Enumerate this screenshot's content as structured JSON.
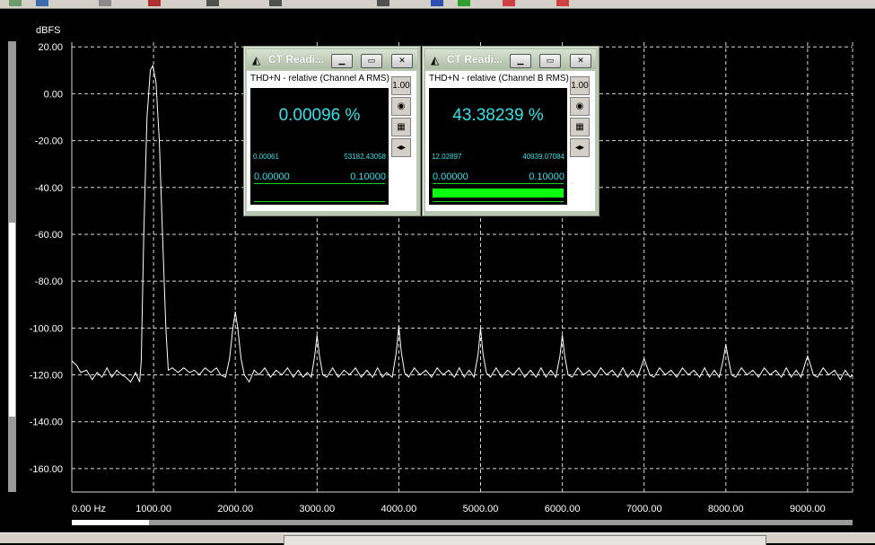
{
  "colors": {
    "background": "#000000",
    "grid": "#d8d8d8",
    "trace": "#ffffff",
    "readout_text": "#36e0e8",
    "bar_fill": "#0cff0c"
  },
  "chart_data": {
    "type": "line",
    "ylabel": "dBFS",
    "xunit": "0.00 Hz",
    "ylim": [
      -170,
      22
    ],
    "xlim": [
      0,
      9550
    ],
    "grid": true,
    "yticks": [
      {
        "v": 20,
        "label": "20.00"
      },
      {
        "v": 0,
        "label": "0.00"
      },
      {
        "v": -20,
        "label": "-20.00"
      },
      {
        "v": -40,
        "label": "-40.00"
      },
      {
        "v": -60,
        "label": "-60.00"
      },
      {
        "v": -80,
        "label": "-80.00"
      },
      {
        "v": -100,
        "label": "-100.00"
      },
      {
        "v": -120,
        "label": "-120.00"
      },
      {
        "v": -140,
        "label": "-140.00"
      },
      {
        "v": -160,
        "label": "-160.00"
      }
    ],
    "xticks": [
      {
        "v": 1000,
        "label": "1000.00"
      },
      {
        "v": 2000,
        "label": "2000.00"
      },
      {
        "v": 3000,
        "label": "3000.00"
      },
      {
        "v": 4000,
        "label": "4000.00"
      },
      {
        "v": 5000,
        "label": "5000.00"
      },
      {
        "v": 6000,
        "label": "6000.00"
      },
      {
        "v": 7000,
        "label": "7000.00"
      },
      {
        "v": 8000,
        "label": "8000.00"
      },
      {
        "v": 9000,
        "label": "9000.00"
      }
    ],
    "series": [
      {
        "points": [
          [
            0,
            -114
          ],
          [
            60,
            -116
          ],
          [
            110,
            -119
          ],
          [
            180,
            -118
          ],
          [
            250,
            -122
          ],
          [
            310,
            -119
          ],
          [
            370,
            -121
          ],
          [
            430,
            -117
          ],
          [
            490,
            -121
          ],
          [
            550,
            -118
          ],
          [
            610,
            -120
          ],
          [
            660,
            -121
          ],
          [
            720,
            -123
          ],
          [
            780,
            -119
          ],
          [
            830,
            -123
          ],
          [
            850,
            -114
          ],
          [
            880,
            -60
          ],
          [
            920,
            -10
          ],
          [
            960,
            10
          ],
          [
            990,
            12
          ],
          [
            1030,
            5
          ],
          [
            1070,
            -20
          ],
          [
            1110,
            -60
          ],
          [
            1150,
            -100
          ],
          [
            1180,
            -118
          ],
          [
            1230,
            -117
          ],
          [
            1300,
            -119
          ],
          [
            1370,
            -117
          ],
          [
            1440,
            -119
          ],
          [
            1500,
            -118
          ],
          [
            1560,
            -120
          ],
          [
            1630,
            -117
          ],
          [
            1700,
            -119
          ],
          [
            1770,
            -117
          ],
          [
            1820,
            -120
          ],
          [
            1880,
            -121
          ],
          [
            1930,
            -113
          ],
          [
            1970,
            -100
          ],
          [
            2000,
            -93
          ],
          [
            2030,
            -100
          ],
          [
            2070,
            -113
          ],
          [
            2110,
            -120
          ],
          [
            2170,
            -123
          ],
          [
            2230,
            -118
          ],
          [
            2290,
            -120
          ],
          [
            2360,
            -117
          ],
          [
            2430,
            -121
          ],
          [
            2500,
            -118
          ],
          [
            2570,
            -120
          ],
          [
            2640,
            -117
          ],
          [
            2710,
            -121
          ],
          [
            2770,
            -118
          ],
          [
            2830,
            -121
          ],
          [
            2880,
            -119
          ],
          [
            2930,
            -121
          ],
          [
            2970,
            -112
          ],
          [
            3000,
            -103
          ],
          [
            3030,
            -112
          ],
          [
            3070,
            -120
          ],
          [
            3120,
            -121
          ],
          [
            3190,
            -117
          ],
          [
            3260,
            -121
          ],
          [
            3330,
            -118
          ],
          [
            3400,
            -120
          ],
          [
            3470,
            -117
          ],
          [
            3540,
            -121
          ],
          [
            3610,
            -118
          ],
          [
            3680,
            -121
          ],
          [
            3740,
            -117
          ],
          [
            3800,
            -121
          ],
          [
            3850,
            -119
          ],
          [
            3920,
            -121
          ],
          [
            3970,
            -110
          ],
          [
            4000,
            -99
          ],
          [
            4030,
            -110
          ],
          [
            4070,
            -119
          ],
          [
            4120,
            -121
          ],
          [
            4190,
            -117
          ],
          [
            4260,
            -120
          ],
          [
            4330,
            -118
          ],
          [
            4400,
            -121
          ],
          [
            4470,
            -117
          ],
          [
            4540,
            -120
          ],
          [
            4610,
            -118
          ],
          [
            4680,
            -121
          ],
          [
            4740,
            -117
          ],
          [
            4800,
            -121
          ],
          [
            4860,
            -118
          ],
          [
            4920,
            -121
          ],
          [
            4970,
            -111
          ],
          [
            5000,
            -100
          ],
          [
            5030,
            -111
          ],
          [
            5070,
            -119
          ],
          [
            5120,
            -121
          ],
          [
            5190,
            -117
          ],
          [
            5260,
            -121
          ],
          [
            5330,
            -118
          ],
          [
            5400,
            -120
          ],
          [
            5470,
            -117
          ],
          [
            5540,
            -121
          ],
          [
            5610,
            -118
          ],
          [
            5680,
            -121
          ],
          [
            5740,
            -117
          ],
          [
            5800,
            -121
          ],
          [
            5860,
            -118
          ],
          [
            5920,
            -121
          ],
          [
            5970,
            -112
          ],
          [
            6000,
            -103
          ],
          [
            6030,
            -112
          ],
          [
            6070,
            -120
          ],
          [
            6120,
            -121
          ],
          [
            6190,
            -117
          ],
          [
            6260,
            -120
          ],
          [
            6330,
            -118
          ],
          [
            6400,
            -121
          ],
          [
            6470,
            -117
          ],
          [
            6540,
            -120
          ],
          [
            6610,
            -118
          ],
          [
            6680,
            -121
          ],
          [
            6740,
            -117
          ],
          [
            6800,
            -121
          ],
          [
            6860,
            -118
          ],
          [
            6920,
            -121
          ],
          [
            6970,
            -116
          ],
          [
            7000,
            -113
          ],
          [
            7030,
            -116
          ],
          [
            7070,
            -120
          ],
          [
            7120,
            -121
          ],
          [
            7190,
            -117
          ],
          [
            7260,
            -120
          ],
          [
            7330,
            -118
          ],
          [
            7400,
            -121
          ],
          [
            7470,
            -117
          ],
          [
            7540,
            -120
          ],
          [
            7610,
            -118
          ],
          [
            7680,
            -121
          ],
          [
            7740,
            -117
          ],
          [
            7800,
            -121
          ],
          [
            7860,
            -118
          ],
          [
            7920,
            -121
          ],
          [
            7970,
            -113
          ],
          [
            8000,
            -107
          ],
          [
            8030,
            -113
          ],
          [
            8070,
            -120
          ],
          [
            8120,
            -121
          ],
          [
            8190,
            -117
          ],
          [
            8260,
            -120
          ],
          [
            8330,
            -118
          ],
          [
            8400,
            -121
          ],
          [
            8470,
            -117
          ],
          [
            8540,
            -120
          ],
          [
            8610,
            -118
          ],
          [
            8680,
            -121
          ],
          [
            8740,
            -117
          ],
          [
            8800,
            -121
          ],
          [
            8860,
            -118
          ],
          [
            8920,
            -121
          ],
          [
            8970,
            -115
          ],
          [
            9000,
            -112
          ],
          [
            9030,
            -115
          ],
          [
            9070,
            -120
          ],
          [
            9120,
            -121
          ],
          [
            9190,
            -117
          ],
          [
            9260,
            -120
          ],
          [
            9330,
            -118
          ],
          [
            9400,
            -122
          ],
          [
            9460,
            -118
          ],
          [
            9520,
            -121
          ],
          [
            9550,
            -120
          ]
        ]
      }
    ]
  },
  "readouts": [
    {
      "title": "CT Readi...",
      "subtitle": "THD+N - relative (Channel A RMS)",
      "value": "0.00096 %",
      "min": "0.00061",
      "max": "53182.43058",
      "range_lo": "0.00000",
      "range_hi": "0.10000",
      "level": 0.0,
      "tool_icons": [
        "scale-icon",
        "meter-icon",
        "table-icon",
        "expand-icon"
      ]
    },
    {
      "title": "CT Readi...",
      "subtitle": "THD+N - relative (Channel B RMS)",
      "value": "43.38239 %",
      "min": "12.02897",
      "max": "40939.07084",
      "range_lo": "0.00000",
      "range_hi": "0.10000",
      "level": 1.0,
      "tool_icons": [
        "scale-icon",
        "meter-icon",
        "table-icon",
        "expand-icon"
      ]
    }
  ],
  "window_buttons": {
    "minimize": "▁",
    "restore": "▭",
    "close": "✕"
  },
  "tool_glyphs": {
    "scale": "1.00",
    "meter": "◉",
    "table": "▦",
    "expand": "◂▸"
  }
}
